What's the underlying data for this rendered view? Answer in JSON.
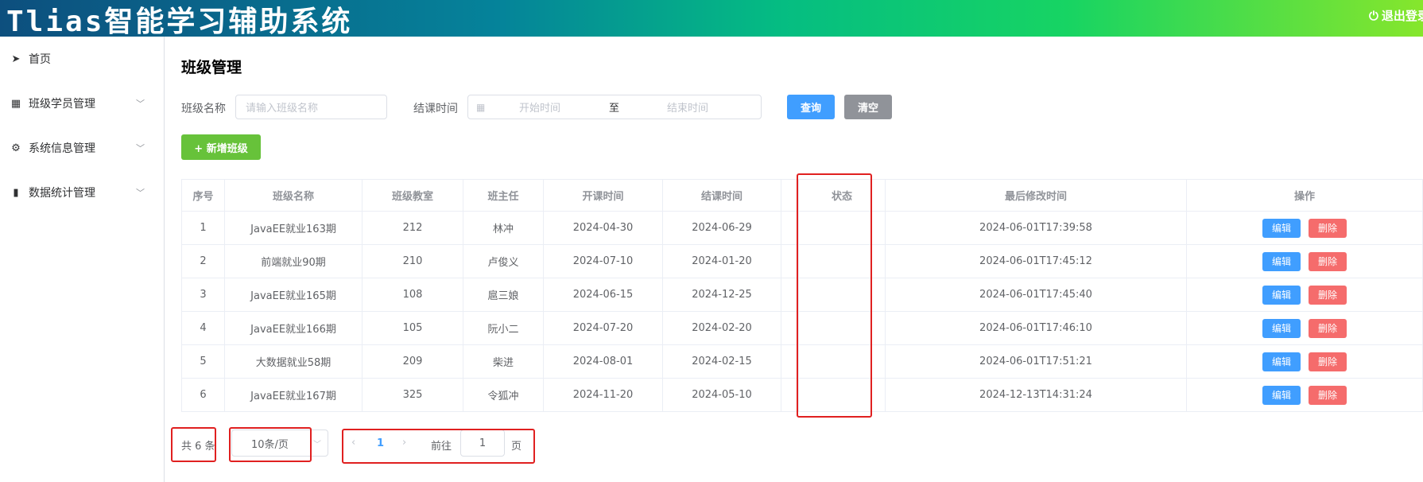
{
  "header": {
    "title": "Tlias智能学习辅助系统",
    "logout": "退出登录",
    "gradient": [
      "#0d4f7e",
      "#05bd82",
      "#86e62c"
    ]
  },
  "sidebar": {
    "items": [
      {
        "label": "首页",
        "icon": "paper-plane-icon"
      },
      {
        "label": "班级学员管理",
        "icon": "grid-icon",
        "expandable": true
      },
      {
        "label": "系统信息管理",
        "icon": "gear-icon",
        "expandable": true
      },
      {
        "label": "数据统计管理",
        "icon": "bar-chart-icon",
        "expandable": true
      }
    ]
  },
  "page": {
    "title": "班级管理"
  },
  "filters": {
    "name_label": "班级名称",
    "name_placeholder": "请输入班级名称",
    "date_label": "结课时间",
    "start_placeholder": "开始时间",
    "separator": "至",
    "end_placeholder": "结束时间",
    "query": "查询",
    "clear": "清空"
  },
  "add_button": "+ 新增班级",
  "table": {
    "headers": [
      "序号",
      "班级名称",
      "班级教室",
      "班主任",
      "开课时间",
      "结课时间",
      "",
      "状态",
      "最后修改时间",
      "操作"
    ],
    "edit": "编辑",
    "delete": "删除",
    "rows": [
      [
        "1",
        "JavaEE就业163期",
        "212",
        "林冲",
        "2024-04-30",
        "2024-06-29",
        "",
        "",
        "2024-06-01T17:39:58"
      ],
      [
        "2",
        "前端就业90期",
        "210",
        "卢俊义",
        "2024-07-10",
        "2024-01-20",
        "",
        "",
        "2024-06-01T17:45:12"
      ],
      [
        "3",
        "JavaEE就业165期",
        "108",
        "扈三娘",
        "2024-06-15",
        "2024-12-25",
        "",
        "",
        "2024-06-01T17:45:40"
      ],
      [
        "4",
        "JavaEE就业166期",
        "105",
        "阮小二",
        "2024-07-20",
        "2024-02-20",
        "",
        "",
        "2024-06-01T17:46:10"
      ],
      [
        "5",
        "大数据就业58期",
        "209",
        "柴进",
        "2024-08-01",
        "2024-02-15",
        "",
        "",
        "2024-06-01T17:51:21"
      ],
      [
        "6",
        "JavaEE就业167期",
        "325",
        "令狐冲",
        "2024-11-20",
        "2024-05-10",
        "",
        "",
        "2024-12-13T14:31:24"
      ]
    ]
  },
  "pagination": {
    "total": "共 6 条",
    "page_size": "10条/页",
    "current_page": "1",
    "goto_label": "前往",
    "goto_value": "1",
    "page_suffix": "页"
  },
  "colors": {
    "primary": "#409eff",
    "success": "#67c23a",
    "info": "#909399",
    "danger": "#f56c6c",
    "highlight": "#e02020"
  }
}
